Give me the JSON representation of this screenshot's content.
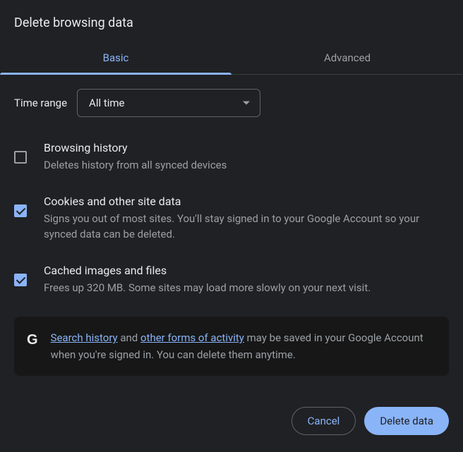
{
  "title": "Delete browsing data",
  "tabs": {
    "basic": "Basic",
    "advanced": "Advanced"
  },
  "time_range": {
    "label": "Time range",
    "selected": "All time"
  },
  "options": [
    {
      "title": "Browsing history",
      "desc": "Deletes history from all synced devices",
      "checked": false
    },
    {
      "title": "Cookies and other site data",
      "desc": "Signs you out of most sites. You'll stay signed in to your Google Account so your synced data can be deleted.",
      "checked": true
    },
    {
      "title": "Cached images and files",
      "desc": "Frees up 320 MB. Some sites may load more slowly on your next visit.",
      "checked": true
    }
  ],
  "info": {
    "link1": "Search history",
    "mid1": " and ",
    "link2": "other forms of activity",
    "rest": " may be saved in your Google Account when you're signed in. You can delete them anytime."
  },
  "buttons": {
    "cancel": "Cancel",
    "delete": "Delete data"
  }
}
